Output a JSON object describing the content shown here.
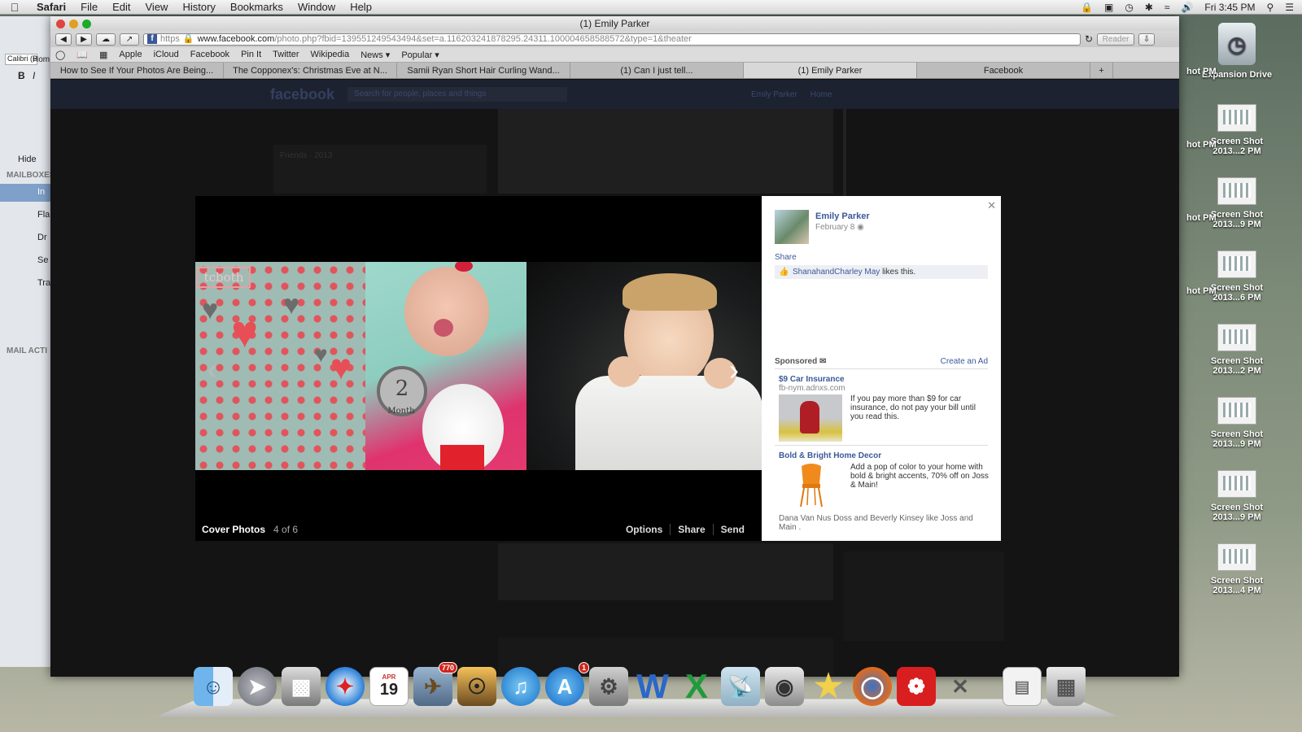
{
  "menubar": {
    "app": "Safari",
    "items": [
      "File",
      "Edit",
      "View",
      "History",
      "Bookmarks",
      "Window",
      "Help"
    ],
    "clock": "Fri 3:45 PM"
  },
  "mail": {
    "font_name": "Calibri (Bod",
    "hide": "Hide",
    "mailboxes": "MAILBOXES",
    "inbox": "In",
    "flagged": "Fla",
    "drafts": "Dr",
    "sent": "Se",
    "trash": "Tra",
    "activity": "MAIL ACTI",
    "home": "Hom"
  },
  "desktop": {
    "drive_label": "Expansion Drive",
    "icons": [
      "Screen Shot 2013...2 PM",
      "Screen Shot 2013...9 PM",
      "Screen Shot 2013...6 PM",
      "Screen Shot 2013...2 PM",
      "Screen Shot 2013...9 PM",
      "Screen Shot 2013...9 PM",
      "Screen Shot 2013...4 PM"
    ],
    "peek": [
      "hot PM",
      "hot PM",
      "hot PM",
      "hot PM"
    ]
  },
  "safari": {
    "title": "(1) Emily Parker",
    "url_scheme": "https",
    "url_domain": "www.facebook.com",
    "url_path": "/photo.php?fbid=139551249543494&set=a.116203241878295.24311.100004658588572&type=1&theater",
    "reader": "Reader",
    "bookmarks": [
      "Apple",
      "iCloud",
      "Facebook",
      "Pin It",
      "Twitter",
      "Wikipedia",
      "News ▾",
      "Popular ▾"
    ],
    "tabs": [
      "How to See If Your Photos Are Being...",
      "The Copponex's: Christmas Eve at N...",
      "Samii Ryan Short Hair Curling Wand...",
      "(1) Can I just tell...",
      "(1) Emily Parker",
      "Facebook"
    ]
  },
  "fb": {
    "logo": "facebook",
    "search_placeholder": "Search for people, places and things",
    "header_name": "Emily Parker",
    "header_home": "Home",
    "friends": "Friends · 2013"
  },
  "theater": {
    "album": "Cover Photos",
    "count": "4 of 6",
    "actions": [
      "Options",
      "Share",
      "Send"
    ],
    "logo_text": "tcboth",
    "month_num": "2",
    "month_word": "Month"
  },
  "panel": {
    "name": "Emily Parker",
    "date": "February 8",
    "share": "Share",
    "liker": "ShanahandCharley May",
    "likes_suffix": " likes this.",
    "sponsored": "Sponsored",
    "create_ad": "Create an Ad",
    "ad1": {
      "title": "$9 Car Insurance",
      "url": "fb-nym.adnxs.com",
      "body": "If you pay more than $9 for car insurance, do not pay your bill until you read this."
    },
    "ad2": {
      "title": "Bold & Bright Home Decor",
      "body": "Add a pop of color to your home with bold & bright accents, 70% off on Joss & Main!"
    },
    "social": "Dana Van Nus Doss and Beverly Kinsey like Joss and Main ."
  },
  "dock": {
    "mail_badge": "770",
    "appstore_badge": "1",
    "ical_month": "APR",
    "ical_day": "19"
  }
}
